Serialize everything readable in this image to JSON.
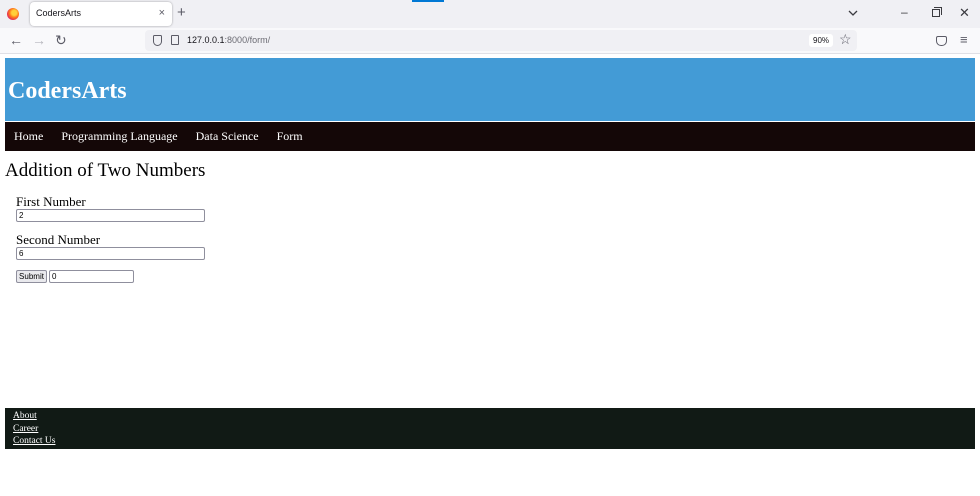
{
  "browser": {
    "tab_title": "CodersArts",
    "tab_close": "×",
    "new_tab": "+",
    "url_host": "127.0.0.1",
    "url_rest": ":8000/form/",
    "zoom": "90%",
    "back": "←",
    "forward": "→",
    "reload": "↻",
    "star": "☆",
    "menu": "≡",
    "win_min": "–",
    "win_close": "✕"
  },
  "site": {
    "title": "CodersArts",
    "colors": {
      "header": "#439bd6",
      "nav": "#140707",
      "footer": "#111a15"
    },
    "nav": [
      {
        "label": "Home"
      },
      {
        "label": "Programming Language"
      },
      {
        "label": "Data Science"
      },
      {
        "label": "Form"
      }
    ],
    "form": {
      "heading": "Addition of Two Numbers",
      "first_label": "First Number",
      "first_value": "2",
      "second_label": "Second Number",
      "second_value": "6",
      "submit_label": "Submit",
      "result_value": "0"
    },
    "footer": [
      {
        "label": "About"
      },
      {
        "label": "Career"
      },
      {
        "label": "Contact Us"
      }
    ]
  }
}
